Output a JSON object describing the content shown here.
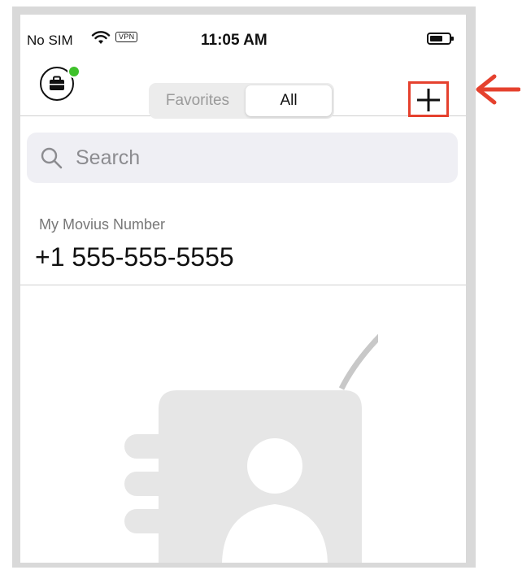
{
  "status_bar": {
    "carrier": "No SIM",
    "vpn": "VPN",
    "time": "11:05 AM"
  },
  "nav": {
    "tabs": [
      {
        "label": "Favorites",
        "selected": false
      },
      {
        "label": "All",
        "selected": true
      }
    ],
    "presence_color": "#3ec12a",
    "add_icon": "plus-icon",
    "highlight_color": "#e5412e"
  },
  "search": {
    "placeholder": "Search",
    "icon": "search-icon"
  },
  "my_number": {
    "label": "My Movius Number",
    "value": "+1 555-555-5555"
  },
  "annotation": {
    "arrow_color": "#e5412e"
  }
}
